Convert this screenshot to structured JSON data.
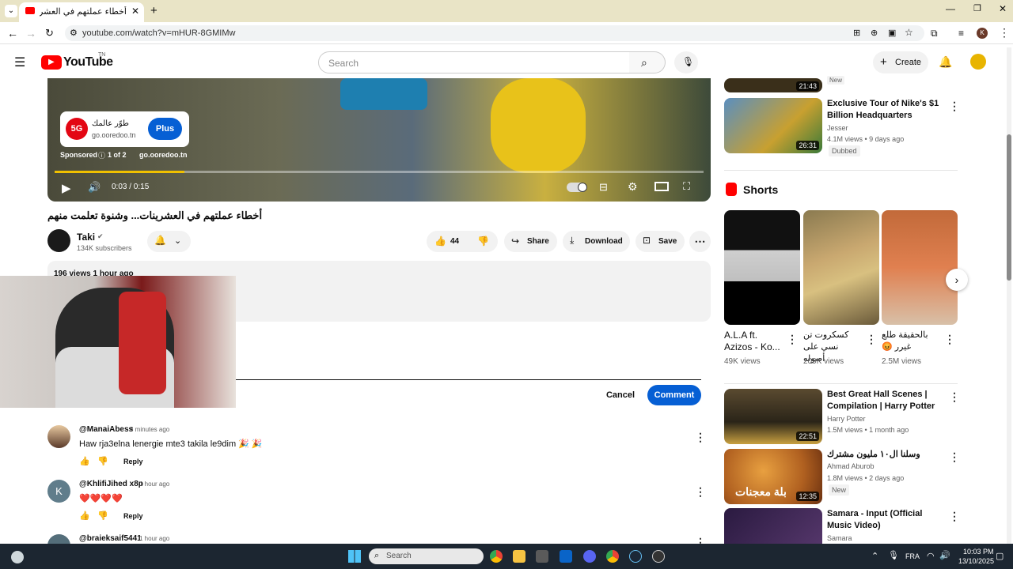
{
  "browser": {
    "tab_title": "أخطاء عملتهم في العشرينات... وش",
    "url": "youtube.com/watch?v=mHUR-8GMIMw"
  },
  "header": {
    "logo_text": "YouTube",
    "region": "TN",
    "search_placeholder": "Search",
    "create_label": "Create"
  },
  "player": {
    "ad": {
      "arabic_text": "طوّر عالمك",
      "domain": "go.ooredoo.tn",
      "badge": "5G",
      "cta": "Plus",
      "sponsored": "Sponsored",
      "ad_count": "1 of 2",
      "ad_domain": "go.ooredoo.tn"
    },
    "time": "0:03 / 0:15",
    "progress": 0.2
  },
  "video": {
    "title": "أخطاء عملتهم في العشرينات... وشنوة تعلمت منهم",
    "channel": "Taki",
    "subscribers": "134K subscribers",
    "likes": "44",
    "share": "Share",
    "download": "Download",
    "save": "Save",
    "description_meta": "196 views 1 hour ago"
  },
  "comment_box": {
    "cancel": "Cancel",
    "comment": "Comment"
  },
  "comments": [
    {
      "author": "@ManaiAbess",
      "time": "8 minutes ago",
      "text": "Haw rja3elna lenergie mte3 takila le9dim 🎉 🎉",
      "reply": "Reply"
    },
    {
      "author": "@KhlifiJihed x8p",
      "time": "1 hour ago",
      "text": "❤️❤️❤️❤️",
      "reply": "Reply"
    },
    {
      "author": "@braieksaif5441",
      "time": "1 hour ago",
      "text": "",
      "reply": "Reply"
    }
  ],
  "sidebar": {
    "top_partial": {
      "duration": "21:43",
      "badge": "New"
    },
    "videos_top": [
      {
        "title": "Exclusive Tour of Nike's $1 Billion Headquarters",
        "channel": "Jesser",
        "stats": "4.1M views • 9 days ago",
        "badge": "Dubbed",
        "duration": "26:31"
      }
    ],
    "shorts_label": "Shorts",
    "shorts": [
      {
        "title": "A.L.A ft. Azizos - Ko...",
        "views": "49K views"
      },
      {
        "title": "كسكروت تن نسي على أصوله",
        "views": "209K views"
      },
      {
        "title": "بالحقيقة طلع غيرر 😡",
        "views": "2.5M views"
      }
    ],
    "videos_bottom": [
      {
        "title": "Best Great Hall Scenes | Compilation | Harry Potter",
        "channel": "Harry Potter",
        "stats": "1.5M views • 1 month ago",
        "badge": "",
        "duration": "22:51"
      },
      {
        "title": "وسلنا ال١٠ مليون مشترك",
        "channel": "Ahmad Aburob",
        "stats": "1.8M views • 2 days ago",
        "badge": "New",
        "duration": "12:35",
        "overlay": "بلة معجنات"
      },
      {
        "title": "Samara - Input (Official Music Video)",
        "channel": "Samara",
        "stats": "",
        "badge": "",
        "duration": ""
      }
    ]
  },
  "taskbar": {
    "search": "Search",
    "lang": "FRA",
    "time": "10:03 PM",
    "date": "13/10/2025"
  },
  "colors": {
    "brand_red": "#ff0000",
    "blue": "#065fd4",
    "progress_yellow": "#f0c000"
  }
}
